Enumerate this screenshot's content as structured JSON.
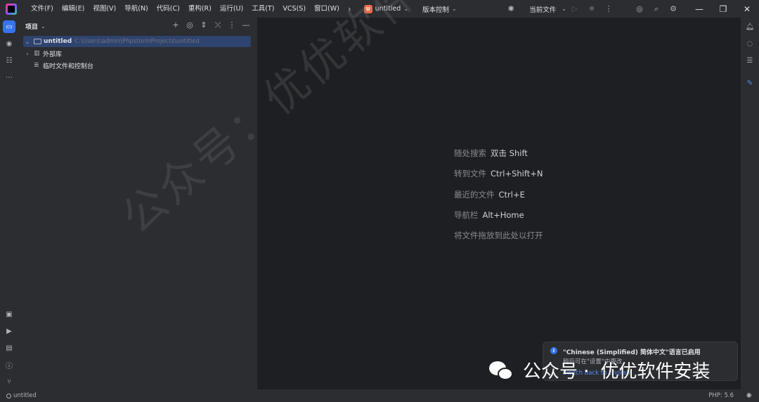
{
  "menu": [
    "文件(F)",
    "编辑(E)",
    "视图(V)",
    "导航(N)",
    "代码(C)",
    "重构(R)",
    "运行(U)",
    "工具(T)",
    "VCS(S)",
    "窗口(W)"
  ],
  "titlebar": {
    "project_badge": "U",
    "project_name": "untitled",
    "vcs_label": "版本控制",
    "current_file": "当前文件"
  },
  "project_panel": {
    "title": "项目",
    "tree": [
      {
        "label": "untitled",
        "path": "C:\\Users\\admin\\PhpstormProjects\\untitled"
      },
      {
        "label": "外部库"
      },
      {
        "label": "临时文件和控制台"
      }
    ]
  },
  "hints": [
    {
      "label": "随处搜索",
      "key": "双击 Shift"
    },
    {
      "label": "转到文件",
      "key": "Ctrl+Shift+N"
    },
    {
      "label": "最近的文件",
      "key": "Ctrl+E"
    },
    {
      "label": "导航栏",
      "key": "Alt+Home"
    },
    {
      "label": "将文件拖放到此处以打开",
      "key": ""
    }
  ],
  "notification": {
    "title": "\"Chinese (Simplified) 简体中文\"语言已启用",
    "body": "稍后可在\"设置\"中更改",
    "link": "Switch back to English"
  },
  "statusbar": {
    "project": "untitled",
    "php_version": "PHP: 5.6"
  },
  "watermarks": {
    "diagonal": "公众号：优优软件安装",
    "brand_left": "公众号 ·",
    "brand_right": "优优软件安装"
  },
  "colors": {
    "accent": "#3574f0",
    "selection": "#2e436e",
    "background": "#1e1f22",
    "panel": "#2b2d30"
  }
}
